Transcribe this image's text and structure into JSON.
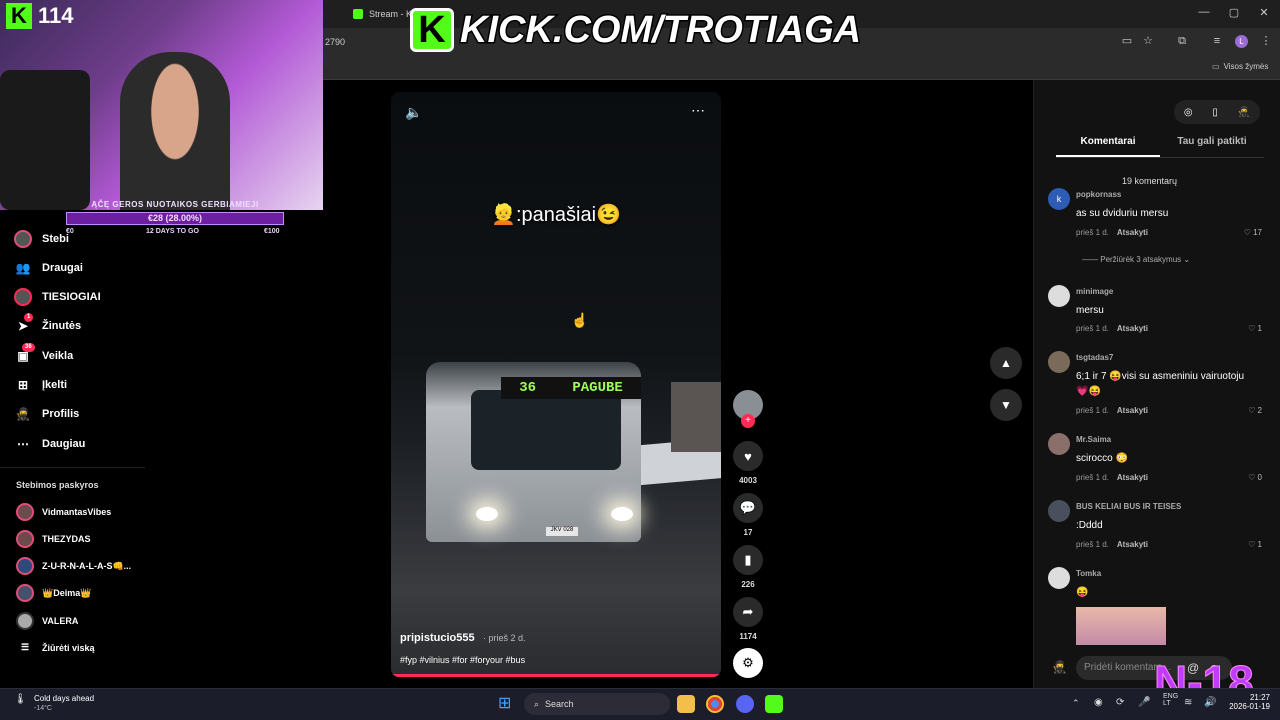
{
  "browser": {
    "tabs": [
      {
        "label": "Stream - Kic"
      }
    ],
    "url_fragment": "2790",
    "bookmarks_label": "Visos žymės",
    "window_controls": [
      "—",
      "▢",
      "✕"
    ]
  },
  "overlay": {
    "viewer_count": "114",
    "banner_text": "KICK.COM/TROTIAGA",
    "goal_title": "ĄČĘ GEROS NUOTAIKOS GERBIAMIEJI",
    "goal_amount": "€28 (28.00%)",
    "goal_start": "€0",
    "goal_days": "12 DAYS TO GO",
    "goal_end": "€100",
    "goal_progress": 0.28,
    "watermark": "N-18"
  },
  "sidebar": {
    "nav": [
      {
        "label": "Stebi",
        "icon": "avatar"
      },
      {
        "label": "Draugai",
        "icon": "friends-icon"
      },
      {
        "label": "TIESIOGIAI",
        "icon": "live-icon"
      },
      {
        "label": "Žinutės",
        "icon": "send-icon",
        "badge": "1"
      },
      {
        "label": "Veikla",
        "icon": "inbox-icon",
        "badge": "36"
      },
      {
        "label": "Įkelti",
        "icon": "upload-icon"
      },
      {
        "label": "Profilis",
        "icon": "profile-icon"
      },
      {
        "label": "Daugiau",
        "icon": "more-icon"
      }
    ],
    "following_title": "Stebimos paskyros",
    "following": [
      {
        "name": "VidmantasVibes"
      },
      {
        "name": "THEZYDAS"
      },
      {
        "name": "Z-U-R-N-A-L-A-S👊..."
      },
      {
        "name": "👑Deima👑"
      },
      {
        "name": "VALERA"
      }
    ],
    "see_all": "Žiūrėti viską"
  },
  "video": {
    "caption": "👱:panašiai😉",
    "author": "pripistucio555",
    "time": "· prieš 2 d.",
    "tags": "#fyp #vilnius #for #foryour #bus",
    "bus_line": "36",
    "bus_destination": "PAGUBE",
    "bus_plate": "JKV 028",
    "progress": 1.0
  },
  "actions": {
    "likes": "4003",
    "comments": "17",
    "saves": "226",
    "shares": "1174"
  },
  "comments_panel": {
    "tabs": [
      "Komentarai",
      "Tau gali patikti"
    ],
    "count_label": "19 komentarų",
    "view_replies": "Peržiūrėk 3 atsakymus",
    "input_placeholder": "Pridėti komentarą...",
    "reply_label": "Atsakyti",
    "items": [
      {
        "user": "popkornass",
        "text": "as su dviduriu mersu",
        "time": "prieš 1 d.",
        "likes": "17"
      },
      {
        "user": "minimage",
        "text": "mersu",
        "time": "prieš 1 d.",
        "likes": "1"
      },
      {
        "user": "tsgtadas7",
        "text": "6;1 ir 7 😝visi su asmeniniu vairuotoju",
        "text2": "💗😝",
        "time": "prieš 1 d.",
        "likes": "2"
      },
      {
        "user": "Mr.Saima",
        "text": "scirocco 😳",
        "time": "prieš 1 d.",
        "likes": "0"
      },
      {
        "user": "BUS KELIAI BUS IR TEISES",
        "text": ":Dddd",
        "time": "prieš 1 d.",
        "likes": "1"
      },
      {
        "user": "Tomka",
        "text": "😝",
        "time": "",
        "likes": ""
      }
    ]
  },
  "taskbar": {
    "weather_title": "Cold days ahead",
    "weather_temp": "-14°C",
    "search": "Search",
    "lang": "ENG",
    "lang2": "LT",
    "time": "21:27",
    "date": "2026-01-19"
  }
}
